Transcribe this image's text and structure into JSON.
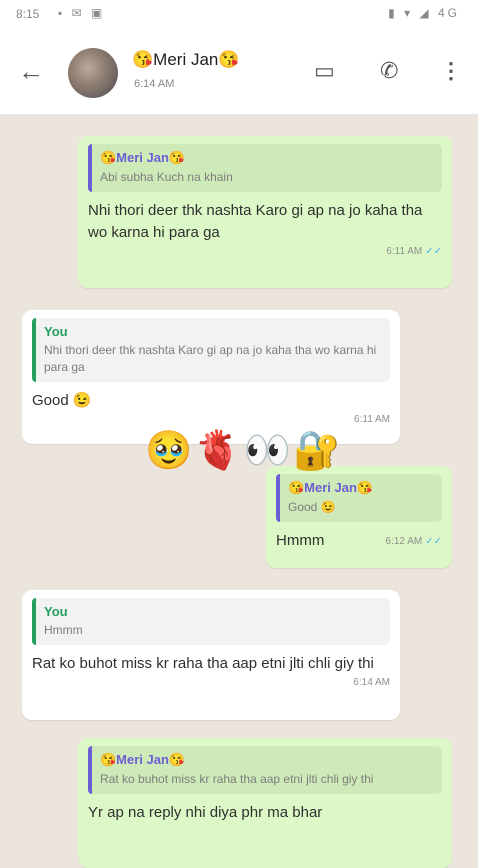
{
  "status_bar": {
    "time": "8:15",
    "right_text": "▮ ▾ ◢ 4G"
  },
  "header": {
    "back_glyph": "←",
    "name": "😘Meri Jan😘",
    "subtitle": "6:14 AM",
    "video_glyph": "▭",
    "call_glyph": "✆",
    "menu_glyph": "⋮"
  },
  "messages": [
    {
      "direction": "out",
      "quote_name": "😘Meri Jan😘",
      "quote_text": "Abi subha Kuch na khain",
      "text": "Nhi thori deer thk nashta Karo gi ap na jo kaha tha wo karna hi para ga",
      "time": "6:11 AM"
    },
    {
      "direction": "in",
      "quote_name": "You",
      "quote_text": "Nhi thori deer thk nashta Karo gi ap na jo kaha tha wo karna hi para ga",
      "text": "Good 😉",
      "time": "6:11 AM"
    },
    {
      "direction": "out",
      "quote_name": "😘Meri Jan😘",
      "quote_text": "Good 😉",
      "text": "Hmmm",
      "time": "6:12 AM"
    },
    {
      "direction": "in",
      "quote_name": "You",
      "quote_text": "Hmmm",
      "text": "Rat ko buhot miss kr raha tha aap etni jlti chli giy thi",
      "time": "6:14 AM"
    },
    {
      "direction": "out",
      "quote_name": "😘Meri Jan😘",
      "quote_text": "Rat ko buhot miss kr raha tha aap etni jlti chli giy thi",
      "text": "Yr ap na reply nhi diya phr ma bhar"
    }
  ],
  "overlay_emojis": [
    "🥹",
    "🫀",
    "👀",
    "🔐"
  ],
  "colors": {
    "chat_bg": "#ece5dd",
    "outgoing": "#dcf8c6",
    "incoming": "#ffffff",
    "quote_bar_out": "#6b5fd3",
    "quote_bar_in": "#25a05c",
    "read_ticks": "#4fb6ec"
  }
}
